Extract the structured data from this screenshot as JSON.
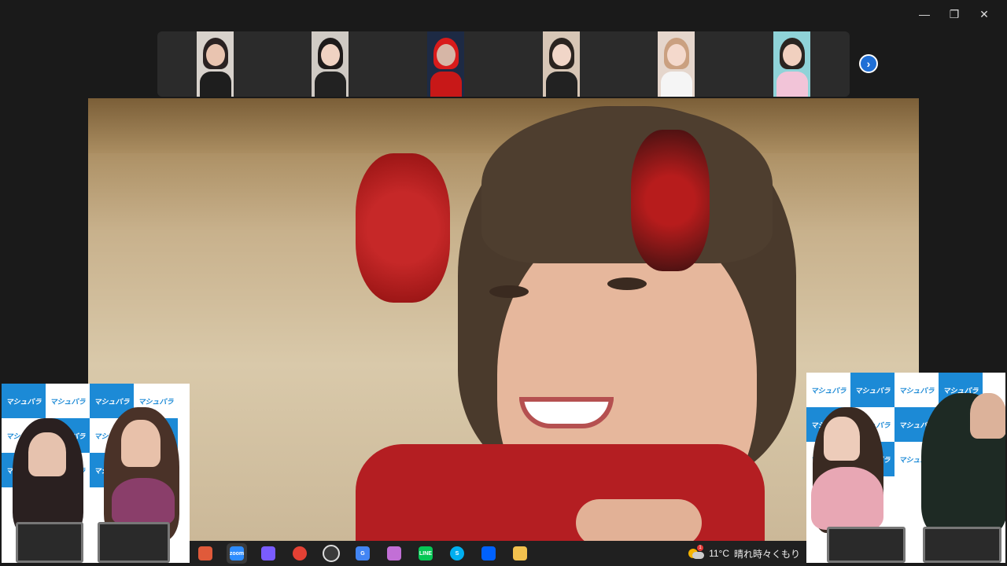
{
  "window": {
    "controls": [
      "minimize",
      "restore",
      "close"
    ]
  },
  "gallery": {
    "participants": [
      {
        "name": "participant-1",
        "hair": "#2a2222",
        "skin": "#e9c4b0",
        "bg": "#d8d2cc",
        "clothes": "#1e1e1e"
      },
      {
        "name": "participant-2",
        "hair": "#1e1a1a",
        "skin": "#f0d2c2",
        "bg": "#cfcac4",
        "clothes": "#222"
      },
      {
        "name": "participant-3",
        "hair": "#d81b1b",
        "skin": "#d6b6a6",
        "bg": "#1d2a44",
        "clothes": "#c81818"
      },
      {
        "name": "participant-4",
        "hair": "#2b2420",
        "skin": "#f1d6c8",
        "bg": "#d7c6b6",
        "clothes": "#222"
      },
      {
        "name": "participant-5",
        "hair": "#caa080",
        "skin": "#f4d9cc",
        "bg": "#e5d6cc",
        "clothes": "#f5f5f5"
      },
      {
        "name": "participant-6",
        "hair": "#2a2420",
        "skin": "#f1d0bf",
        "bg": "#8fd3d8",
        "clothes": "#f2c4d8"
      }
    ],
    "next_icon": "chevron-right-icon"
  },
  "pip": {
    "backdrop_logo": "マシュバラ"
  },
  "taskbar": {
    "apps": [
      {
        "name": "gift-app",
        "label": "",
        "color": "#e05a3a",
        "active": false
      },
      {
        "name": "zoom-app",
        "label": "zoom",
        "color": "#2d8cff",
        "active": true
      },
      {
        "name": "copilot-app",
        "label": "",
        "color": "#7a5cff",
        "active": false
      },
      {
        "name": "chrome-app",
        "label": "",
        "color": "#e44134",
        "active": false
      },
      {
        "name": "obs-app",
        "label": "",
        "color": "#3a3a3a",
        "active": false
      },
      {
        "name": "search-app",
        "label": "G",
        "color": "#4285f4",
        "active": false
      },
      {
        "name": "notepad-app",
        "label": "",
        "color": "#c26fd6",
        "active": false
      },
      {
        "name": "line-app",
        "label": "LINE",
        "color": "#06c755",
        "active": false
      },
      {
        "name": "skype-app",
        "label": "S",
        "color": "#00aff0",
        "active": false
      },
      {
        "name": "dropbox-app",
        "label": "",
        "color": "#0061fe",
        "active": false
      },
      {
        "name": "explorer-app",
        "label": "",
        "color": "#f2c14e",
        "active": false
      }
    ],
    "weather": {
      "temperature": "11°C",
      "condition": "晴れ時々くもり",
      "badge": "1"
    }
  }
}
